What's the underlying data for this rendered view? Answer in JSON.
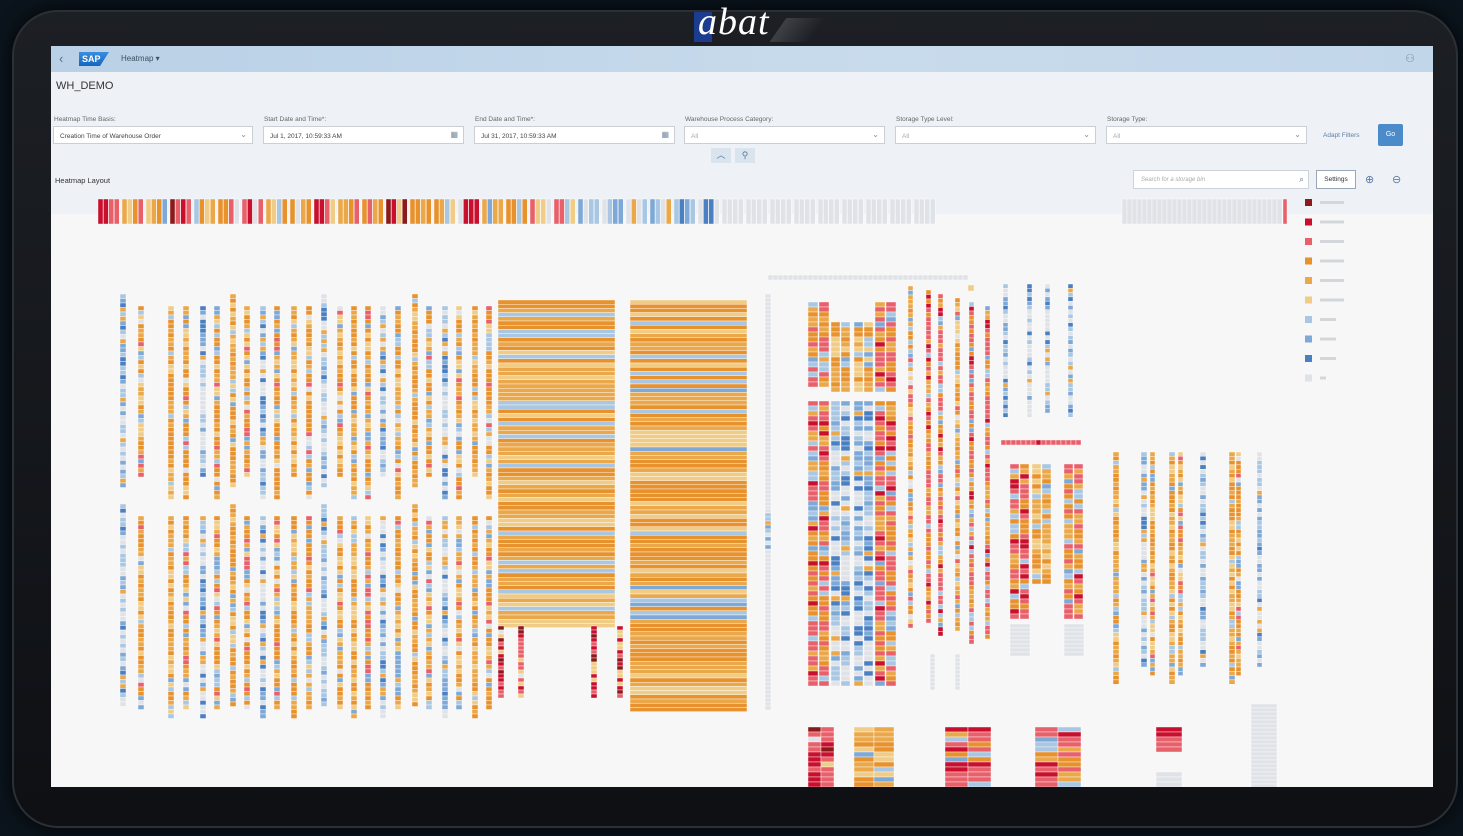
{
  "brand": {
    "logo_text": "abat"
  },
  "shell": {
    "back_icon": "chevron-left-icon",
    "sap_logo": "SAP",
    "app_title": "Heatmap ▾",
    "user_icon": "person-icon"
  },
  "header": {
    "page_title": "WH_DEMO"
  },
  "filters": {
    "time_basis": {
      "label": "Heatmap Time Basis:",
      "value": "Creation Time of Warehouse Order"
    },
    "start": {
      "label": "Start Date and Time*:",
      "value": "Jul 1, 2017, 10:59:33 AM"
    },
    "end": {
      "label": "End Date and Time*:",
      "value": "Jul 31, 2017, 10:59:33 AM"
    },
    "process_category": {
      "label": "Warehouse Process Category:",
      "value": "All"
    },
    "storage_type_level": {
      "label": "Storage Type Level:",
      "value": "All"
    },
    "storage_type": {
      "label": "Storage Type:",
      "value": "All"
    },
    "adapt_filters": "Adapt Filters",
    "go": "Go"
  },
  "layout": {
    "section_title": "Heatmap Layout",
    "search_placeholder": "Search for a storage bin",
    "settings": "Settings"
  },
  "colors": {
    "c9": "#8b1a1a",
    "c8": "#c8102e",
    "c7": "#e8606a",
    "c6": "#e8922e",
    "c5": "#eba84a",
    "c4": "#f0cc86",
    "c3": "#a9c7e3",
    "c2": "#7ea9d6",
    "c1": "#4a7fc1",
    "c0": "#dfe2e6"
  },
  "legend": {
    "swatches": [
      "c9",
      "c8",
      "c7",
      "c6",
      "c5",
      "c4",
      "c3",
      "c2",
      "c1",
      "c0"
    ]
  }
}
